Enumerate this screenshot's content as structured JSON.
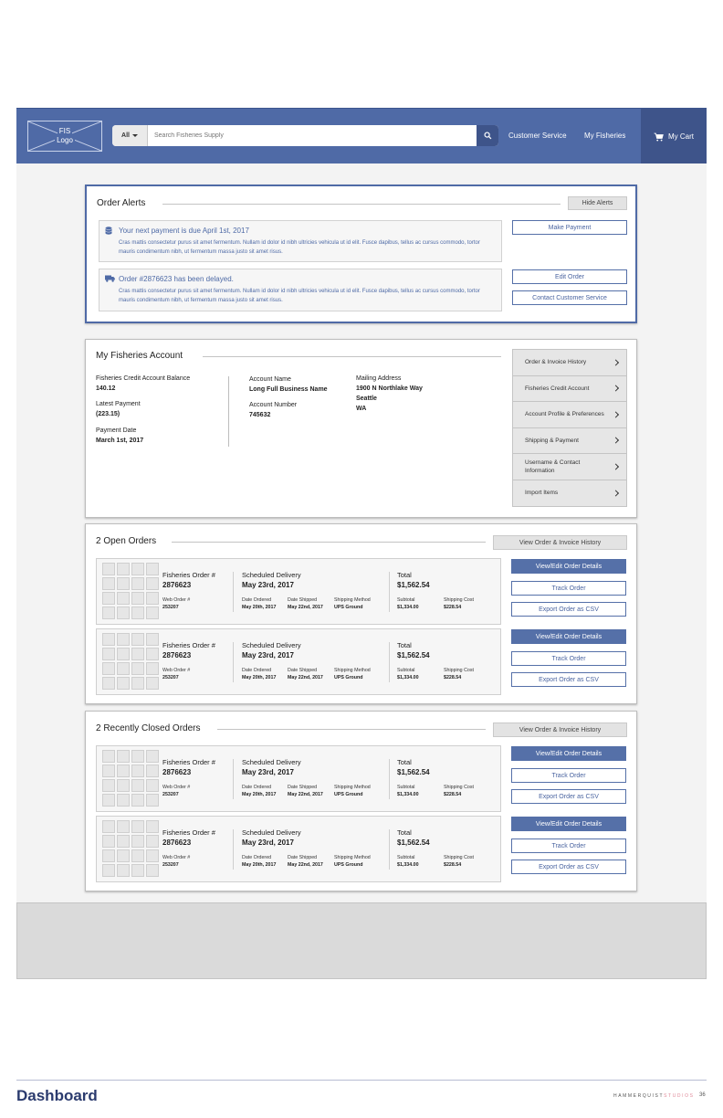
{
  "header": {
    "logo_line1": "FIS",
    "logo_line2": "Logo",
    "search_scope": "All",
    "search_placeholder": "Search Fisheries Supply",
    "nav": [
      "Customer Service",
      "My Fisheries"
    ],
    "cart_label": "My Cart"
  },
  "alerts": {
    "title": "Order Alerts",
    "hide_label": "Hide Alerts",
    "items": [
      {
        "icon": "database-icon",
        "heading": "Your next payment is due April 1st, 2017",
        "body": "Cras mattis consectetur purus sit amet fermentum. Nullam id dolor id nibh ultricies vehicula ut id elit. Fusce dapibus, tellus ac cursus commodo, tortor mauris condimentum nibh, ut fermentum massa justo sit amet risus.",
        "actions": [
          "Make Payment"
        ]
      },
      {
        "icon": "truck-icon",
        "heading": "Order #2876623 has been delayed.",
        "body": "Cras mattis consectetur purus sit amet fermentum. Nullam id dolor id nibh ultricies vehicula ut id elit. Fusce dapibus, tellus ac cursus commodo, tortor mauris condimentum nibh, ut fermentum massa justo sit amet risus.",
        "actions": [
          "Edit Order",
          "Contact Customer Service"
        ]
      }
    ]
  },
  "account": {
    "title": "My Fisheries Account",
    "credit_balance_label": "Fisheries Credit Account Balance",
    "credit_balance_value": "140.12",
    "latest_payment_label": "Latest Payment",
    "latest_payment_value": "(223.15)",
    "payment_date_label": "Payment Date",
    "payment_date_value": "March 1st, 2017",
    "account_name_label": "Account Name",
    "account_name_value": "Long Full Business Name",
    "account_number_label": "Account Number",
    "account_number_value": "745632",
    "mailing_label": "Mailing Address",
    "mailing_line1": "1900 N Northlake Way",
    "mailing_line2": "Seattle",
    "mailing_line3": "WA",
    "nav": [
      "Order & Invoice History",
      "Fisheries Credit Account",
      "Account Profile & Preferences",
      "Shipping & Payment",
      "Username & Contact Information",
      "Import Items"
    ]
  },
  "open_orders": {
    "title": "2 Open Orders",
    "history_label": "View Order & Invoice History",
    "orders": [
      {
        "order_label": "Fisheries Order #",
        "order_no": "2876623",
        "web_label": "Web Order #",
        "web_no": "253207",
        "sched_label": "Scheduled Delivery",
        "sched_date": "May 23rd, 2017",
        "ordered_label": "Date Ordered",
        "ordered": "May 20th, 2017",
        "shipped_label": "Date Shipped",
        "shipped": "May 22nd, 2017",
        "method_label": "Shipping Method",
        "method": "UPS Ground",
        "total_label": "Total",
        "total": "$1,562.54",
        "subtotal_label": "Subtotal",
        "subtotal": "$1,334.00",
        "shipcost_label": "Shipping Cost",
        "shipcost": "$228.54",
        "actions": [
          "View/Edit Order Details",
          "Track Order",
          "Export Order as CSV"
        ]
      },
      {
        "order_label": "Fisheries Order #",
        "order_no": "2876623",
        "web_label": "Web Order #",
        "web_no": "253207",
        "sched_label": "Scheduled Delivery",
        "sched_date": "May 23rd, 2017",
        "ordered_label": "Date Ordered",
        "ordered": "May 20th, 2017",
        "shipped_label": "Date Shipped",
        "shipped": "May 22nd, 2017",
        "method_label": "Shipping Method",
        "method": "UPS Ground",
        "total_label": "Total",
        "total": "$1,562.54",
        "subtotal_label": "Subtotal",
        "subtotal": "$1,334.00",
        "shipcost_label": "Shipping Cost",
        "shipcost": "$228.54",
        "actions": [
          "View/Edit Order Details",
          "Track Order",
          "Export Order as CSV"
        ]
      }
    ]
  },
  "closed_orders": {
    "title": "2 Recently Closed Orders",
    "history_label": "View Order & Invoice History",
    "orders": [
      {
        "order_label": "Fisheries Order #",
        "order_no": "2876623",
        "web_label": "Web Order #",
        "web_no": "253207",
        "sched_label": "Scheduled Delivery",
        "sched_date": "May 23rd, 2017",
        "ordered_label": "Date Ordered",
        "ordered": "May 20th, 2017",
        "shipped_label": "Date Shipped",
        "shipped": "May 22nd, 2017",
        "method_label": "Shipping Method",
        "method": "UPS Ground",
        "total_label": "Total",
        "total": "$1,562.54",
        "subtotal_label": "Subtotal",
        "subtotal": "$1,334.00",
        "shipcost_label": "Shipping Cost",
        "shipcost": "$228.54",
        "actions": [
          "View/Edit Order Details",
          "Track Order",
          "Export Order as CSV"
        ]
      },
      {
        "order_label": "Fisheries Order #",
        "order_no": "2876623",
        "web_label": "Web Order #",
        "web_no": "253207",
        "sched_label": "Scheduled Delivery",
        "sched_date": "May 23rd, 2017",
        "ordered_label": "Date Ordered",
        "ordered": "May 20th, 2017",
        "shipped_label": "Date Shipped",
        "shipped": "May 22nd, 2017",
        "method_label": "Shipping Method",
        "method": "UPS Ground",
        "total_label": "Total",
        "total": "$1,562.54",
        "subtotal_label": "Subtotal",
        "subtotal": "$1,334.00",
        "shipcost_label": "Shipping Cost",
        "shipcost": "$228.54",
        "actions": [
          "View/Edit Order Details",
          "Track Order",
          "Export Order as CSV"
        ]
      }
    ]
  },
  "footer": {
    "page_title": "Dashboard",
    "brand_main": "HAMMERQUIST",
    "brand_studios": "STUDIOS",
    "page_number": "36"
  },
  "colors": {
    "brand_blue": "#4f6aa6",
    "dark_blue": "#3e548a",
    "footer_navy": "#2b3b6e"
  }
}
